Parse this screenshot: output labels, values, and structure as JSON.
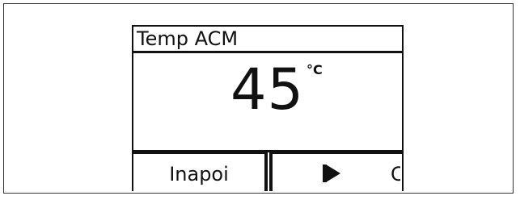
{
  "display": {
    "title": "Temp ACM",
    "value": "45",
    "unit": "°C"
  },
  "softkeys": {
    "left_label": "Inapoi",
    "right_icon": "play-icon",
    "right_label": "C"
  }
}
